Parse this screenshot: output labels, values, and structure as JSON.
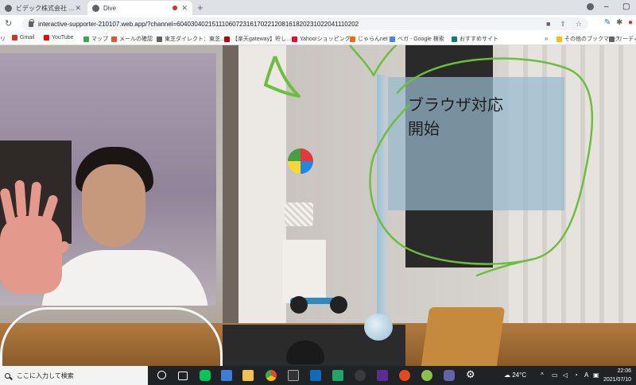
{
  "browser": {
    "tabs": [
      {
        "label": "ビデック株式会社 - AR/MRでクラ",
        "active": false
      },
      {
        "label": "Dive",
        "active": true,
        "recording": true
      }
    ],
    "url": "interactive-supporter-210107.web.app/?channel=6040304021511106072316170221208161820231022041110202",
    "bookmarks": [
      {
        "label": "Gmail",
        "icon": "gmail-icon",
        "color": "#d93025"
      },
      {
        "label": "YouTube",
        "icon": "youtube-icon",
        "color": "#ff0000"
      },
      {
        "label": "マップ",
        "icon": "maps-icon",
        "color": "#34a853"
      },
      {
        "label": "メールの確認",
        "icon": "microsoft-icon",
        "color": "#f25022"
      },
      {
        "label": "東芝ダイレクト：東芝...",
        "icon": "toshiba-icon",
        "color": "#5f6368"
      },
      {
        "label": "【楽天gateway】貯し...",
        "icon": "rakuten-icon",
        "color": "#bf0000"
      },
      {
        "label": "Yahoo!ショッピング",
        "icon": "yahoo-icon",
        "color": "#ff0033"
      },
      {
        "label": "じゃらんnet",
        "icon": "jalan-icon",
        "color": "#ff6600"
      },
      {
        "label": "ベガ - Google 検索",
        "icon": "google-icon",
        "color": "#4285f4"
      },
      {
        "label": "おすすめサイト",
        "icon": "bing-icon",
        "color": "#008373"
      }
    ],
    "other_bookmarks": "その他のブックマーク",
    "reading_list": "リーディン"
  },
  "ar_overlay": {
    "text": "ブラウザ対応\n開始",
    "panel_color": "#96bacd",
    "stroke_color": "#6cbf3a"
  },
  "taskbar": {
    "search_placeholder": "ここに入力して検索",
    "weather": "24°C",
    "time": "22:06",
    "date": "2021/07/10"
  }
}
